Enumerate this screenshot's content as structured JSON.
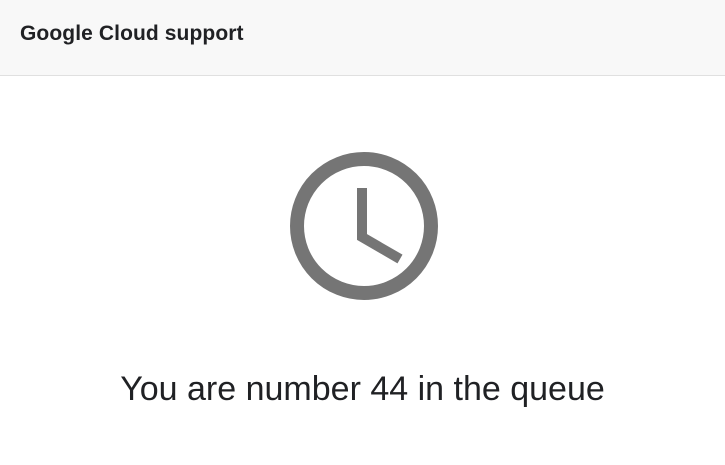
{
  "header": {
    "title": "Google Cloud support"
  },
  "main": {
    "icon": "clock-icon",
    "queue_message": "You are number 44 in the queue"
  },
  "colors": {
    "icon": "#757575",
    "header_bg": "#f8f8f8",
    "text": "#202124"
  }
}
